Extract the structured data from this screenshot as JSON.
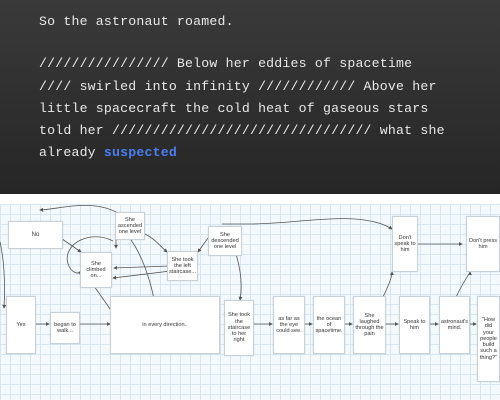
{
  "editor": {
    "lines": [
      "So the astronaut roamed.",
      "//////////////// Below her eddies of spacetime",
      "//// swirled into infinity //////////// Above her",
      "little spacecraft the cold heat of gaseous stars",
      "told her //////////////////////////////// what she",
      "already "
    ],
    "highlight_word": "suspected"
  },
  "flow_nodes": {
    "no": "No",
    "yes": "Yes",
    "began_to_walk": "began to walk...",
    "she_climbed_on": "She climbed on...",
    "she_ascended_one_level": "She ascended one level",
    "she_took_left_staircase": "She took the left staircase...",
    "she_descended_one_level": "She descended one level",
    "in_every_direction": "in every direction..",
    "she_took_staircase_right": "She took the staircase to her right",
    "as_far_as_eye": "as far as the eye could see.",
    "ocean_of_spacetime": "the ocean of spacetime.",
    "she_laughed": "She laughed through the pain",
    "speak_to_him": "Speak to him",
    "astronauts_mind": "astronaut's mind.",
    "how_did_your_people": "\"How did your people build such a thing?\"",
    "dont_speak_to_him": "Don't speak to him",
    "dont_press_him": "Don't press him"
  }
}
